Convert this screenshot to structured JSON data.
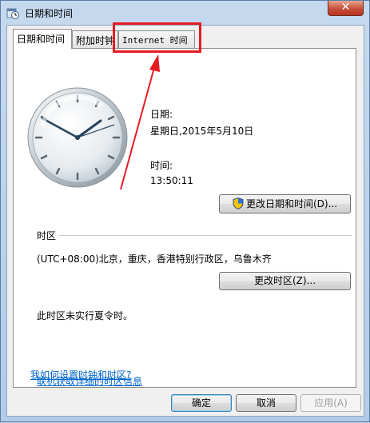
{
  "window": {
    "title": "日期和时间",
    "close_symbol": "✕"
  },
  "tabs": [
    {
      "label": "日期和时间"
    },
    {
      "label": "附加时钟"
    },
    {
      "label": "Internet 时间"
    }
  ],
  "datetime": {
    "date_label": "日期:",
    "date_value": "星期日,2015年5月10日",
    "time_label": "时间:",
    "time_value": "13:50:11",
    "change_button": "更改日期和时间(D)..."
  },
  "timezone": {
    "section_label": "时区",
    "value": "(UTC+08:00)北京，重庆，香港特别行政区，乌鲁木齐",
    "change_button": "更改时区(Z)...",
    "dst_note": "此时区未实行夏令时。"
  },
  "links": {
    "online_info": "联机获取详细的时区信息",
    "how_to_set": "我如何设置时钟和时区?"
  },
  "footer": {
    "ok": "确定",
    "cancel": "取消",
    "apply": "应用(A)"
  },
  "colors": {
    "annotation": "#e51c23",
    "link": "#0066cc",
    "close_button": "#c7503a"
  }
}
